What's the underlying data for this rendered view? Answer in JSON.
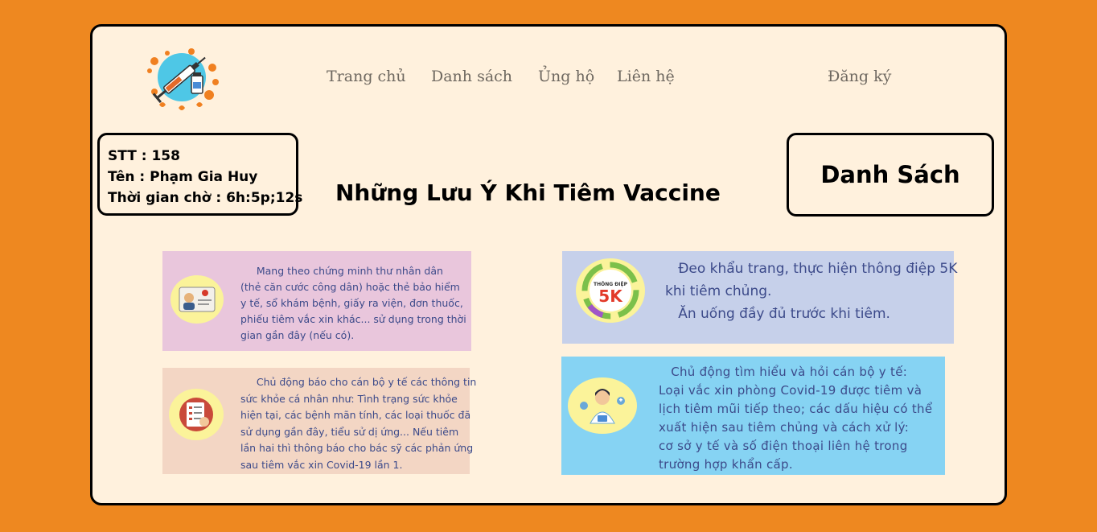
{
  "nav": {
    "home": "Trang chủ",
    "list": "Danh sách",
    "support": "Ủng hộ",
    "contact": "Liên hệ",
    "register": "Đăng ký"
  },
  "logo": {
    "icon": "vaccine-syringe-logo",
    "colors": {
      "circle": "#4ec7e6",
      "splash": "#f08020"
    }
  },
  "info": {
    "stt": "STT : 158",
    "name": "Tên : Phạm Gia Huy",
    "wait": "Thời gian chờ :  6h:5p;12s"
  },
  "list_button": "Danh Sách",
  "title": "Những Lưu Ý Khi Tiêm Vaccine",
  "cards": [
    {
      "icon": "id-card-icon",
      "lines": [
        "     Mang theo chứng minh thư nhân dân",
        "(thẻ căn cước công dân) hoặc thẻ bảo hiểm",
        "y tế, sổ khám bệnh, giấy ra viện, đơn thuốc,",
        "phiếu tiêm vắc xin khác... sử dụng trong thời",
        "gian gần đây (nếu có)."
      ]
    },
    {
      "icon": "health-checklist-icon",
      "lines": [
        "     Chủ động báo cho cán bộ y tế các thông tin",
        "sức khỏe cá nhân như: Tình trạng sức khỏe",
        "hiện tại, các bệnh mãn tính, các loại thuốc đã",
        "sử dụng gần đây, tiểu sử dị ứng... Nếu tiêm",
        "lần hai thì thông báo cho bác sỹ các phản ứng",
        "sau tiêm vắc xin Covid-19 lần 1."
      ]
    },
    {
      "icon": "message-5k-icon",
      "badge_top": "THÔNG ĐIỆP",
      "badge_main": "5K",
      "lines": [
        "   Đeo khẩu trang, thực hiện thông điệp 5K",
        "khi tiêm chủng.",
        "   Ăn uống đầy đủ trước khi tiêm."
      ]
    },
    {
      "icon": "doctor-icon",
      "lines": [
        "   Chủ động tìm hiểu và hỏi cán bộ y tế:",
        "Loại vắc xin phòng Covid-19 được tiêm và",
        "lịch tiêm mũi tiếp theo; các dấu hiệu có thể",
        "xuất hiện sau tiêm chủng và cách xử lý:",
        "cơ sở y tế và số điện thoại liên hệ trong",
        "trường hợp khẩn cấp."
      ]
    }
  ]
}
